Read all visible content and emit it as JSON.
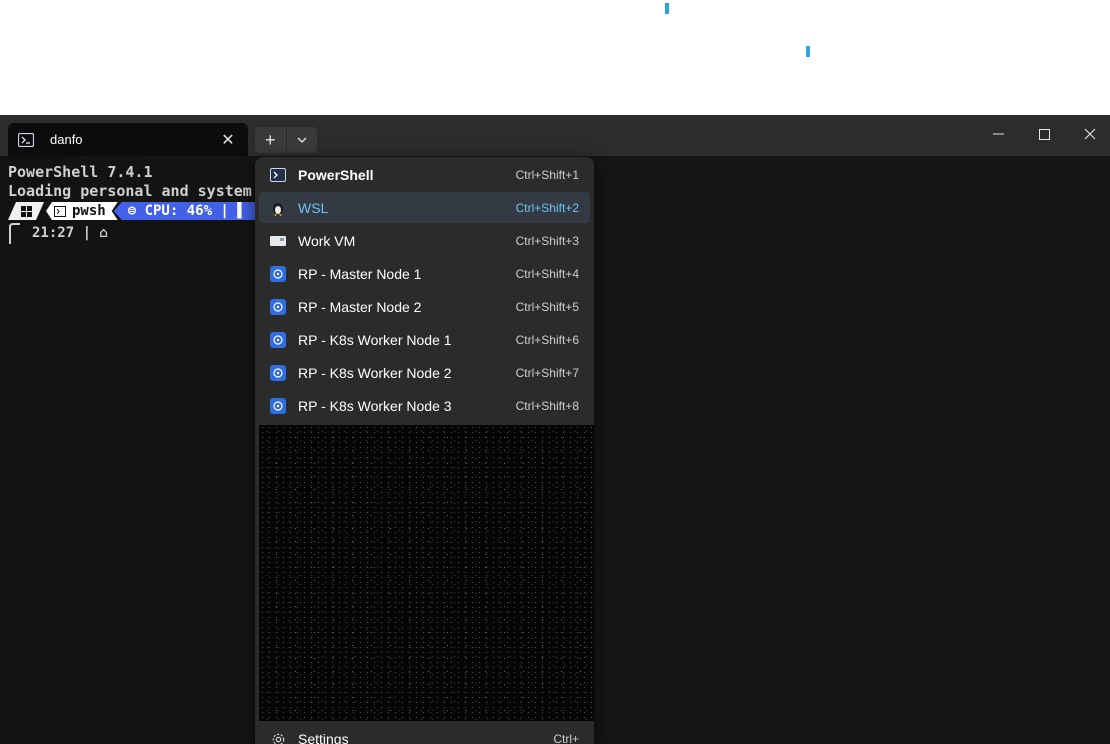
{
  "window": {
    "tab": {
      "label": "danfo"
    },
    "controls": [
      "minimize",
      "maximize",
      "close"
    ]
  },
  "terminal": {
    "line1": "PowerShell 7.4.1",
    "line2": "Loading personal and system",
    "prompt": {
      "shell": "pwsh",
      "cpu": "⊜ CPU: 46% | ▌"
    },
    "time": "21:27 | ⌂"
  },
  "menu": {
    "items": [
      {
        "label": "PowerShell",
        "shortcut": "Ctrl+Shift+1",
        "icon": "powershell-icon"
      },
      {
        "label": "WSL",
        "shortcut": "Ctrl+Shift+2",
        "icon": "linux-penguin-icon"
      },
      {
        "label": "Work VM",
        "shortcut": "Ctrl+Shift+3",
        "icon": "vm-icon"
      },
      {
        "label": "RP - Master Node 1",
        "shortcut": "Ctrl+Shift+4",
        "icon": "kubernetes-icon"
      },
      {
        "label": "RP - Master Node 2",
        "shortcut": "Ctrl+Shift+5",
        "icon": "kubernetes-icon"
      },
      {
        "label": "RP - K8s Worker Node 1",
        "shortcut": "Ctrl+Shift+6",
        "icon": "kubernetes-icon"
      },
      {
        "label": "RP - K8s Worker Node 2",
        "shortcut": "Ctrl+Shift+7",
        "icon": "kubernetes-icon"
      },
      {
        "label": "RP - K8s Worker Node 3",
        "shortcut": "Ctrl+Shift+8",
        "icon": "kubernetes-icon"
      }
    ],
    "settings": {
      "label": "Settings",
      "shortcut": "Ctrl+"
    }
  },
  "colors": {
    "accent": "#6cc5f0",
    "cpu_segment": "#4361e8",
    "cursor_mark": "#29a8e0"
  }
}
